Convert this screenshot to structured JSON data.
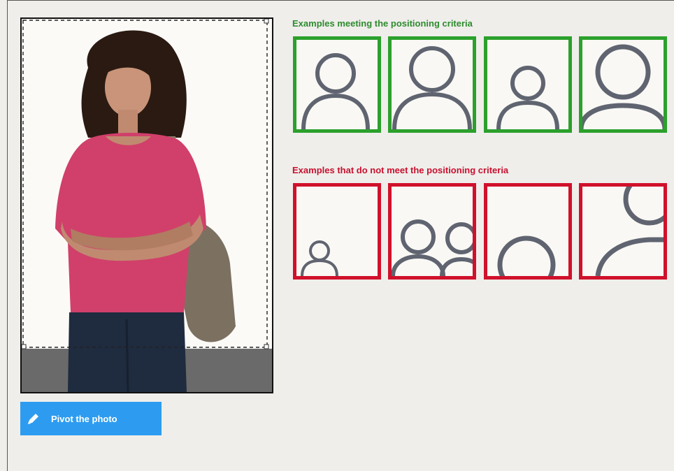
{
  "good_examples": {
    "title": "Examples meeting the positioning criteria",
    "border_color": "#2ca02c",
    "items": [
      "person-icon",
      "person-icon",
      "person-icon",
      "person-icon"
    ]
  },
  "bad_examples": {
    "title": "Examples that do not meet the positioning criteria",
    "border_color": "#d0112b",
    "items": [
      "person-icon",
      "two-persons-icon",
      "person-icon",
      "person-icon"
    ]
  },
  "photo": {
    "subject": "person-photo"
  },
  "pivot_button": {
    "label": "Pivot the photo",
    "icon": "pencil-icon",
    "color": "#2d9cf0"
  }
}
